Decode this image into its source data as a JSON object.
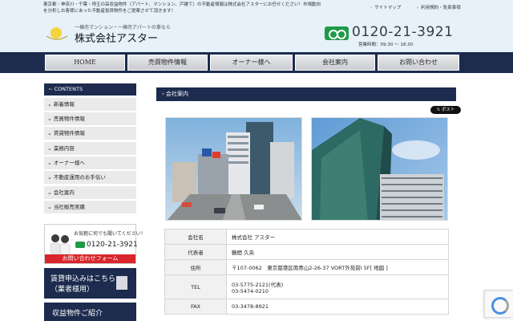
{
  "header": {
    "message_line1": "東京都・神奈川・千葉・埼玉の高収益物件（アパート、マンション、戸建て）の不動産情報は株式会社アスターにお任せください！市場動向",
    "message_line2": "を分析しお客様にあった不動産投資物件をご提案させて頂きます！",
    "links": [
      "サイトマップ",
      "利用規約・免責事項"
    ],
    "logo_tagline": "一棟売マンション・一棟売アパートの事なら",
    "company_name": "株式会社アスター",
    "phone": "0120-21-3921",
    "hours": "営業時間：09:30 ～ 18:30"
  },
  "nav": [
    "HOME",
    "売買物件情報",
    "オーナー様へ",
    "会社案内",
    "お問い合わせ"
  ],
  "sidebar": {
    "heading": "CONTENTS",
    "items": [
      "新着情報",
      "売買物件情報",
      "賃貸物件情報",
      "業務内容",
      "オーナー様へ",
      "不動産運用のお手伝い",
      "会社案内",
      "当社販売実績"
    ]
  },
  "banners": {
    "contact_top": "お気軽に何でも聞いてください！",
    "contact_phone": "0120-21-3921",
    "contact_form": "お問い合わせフォーム",
    "rent_line1": "賃貸申込みはこちら",
    "rent_line2": "（業者様用）",
    "income": "収益物件ご紹介"
  },
  "main": {
    "section_title": "会社案内",
    "post_button": "ポスト",
    "table": [
      {
        "key": "会社名",
        "value": "株式会社 アスター"
      },
      {
        "key": "代表者",
        "value": "鶴間 久央"
      },
      {
        "key": "住所",
        "value": "〒107-0062　東京都港区南青山2-26-37 VORT外苑前Ⅰ 5F[ 地図 ]"
      },
      {
        "key": "TEL",
        "value": "03-5775-2121(代表)",
        "value2": "03-5474-0210"
      },
      {
        "key": "FAX",
        "value": "03-3478-8921"
      }
    ]
  },
  "colors": {
    "navy": "#1c2b4e",
    "header_bg": "#e6f1fa",
    "freedial_green": "#1f9a48",
    "form_red": "#d9252b"
  }
}
